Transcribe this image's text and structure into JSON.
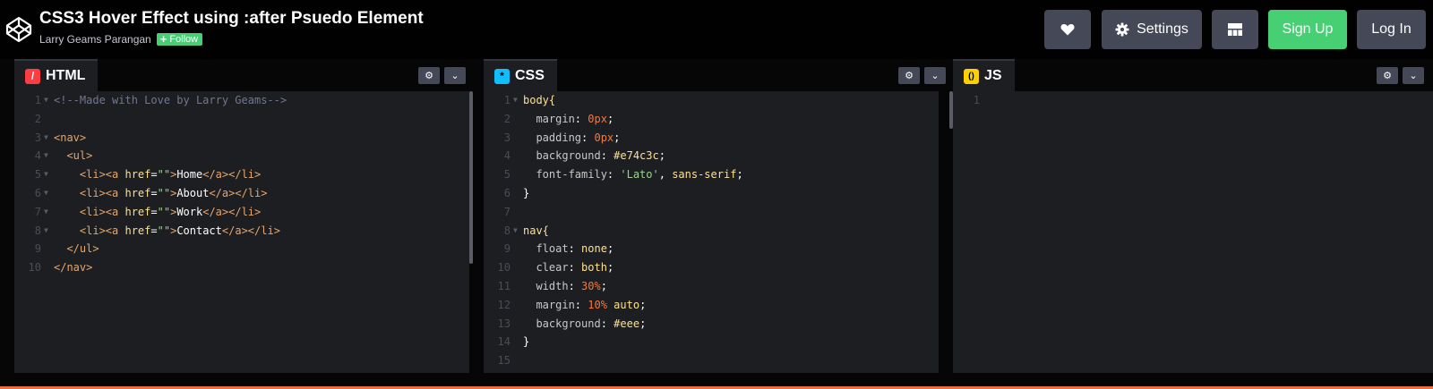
{
  "header": {
    "title": "CSS3 Hover Effect using :after Psuedo Element",
    "author": "Larry Geams Parangan",
    "follow_label": "Follow",
    "settings_label": "Settings",
    "signup_label": "Sign Up",
    "login_label": "Log In"
  },
  "editors": {
    "html": {
      "label": "HTML",
      "icon": "/",
      "lines": [
        [
          {
            "t": "<!--Made with Love by Larry Geams-->",
            "c": "t-comment"
          }
        ],
        [],
        [
          {
            "t": "<nav>",
            "c": "t-tag"
          }
        ],
        [
          {
            "t": "  <ul>",
            "c": "t-tag"
          }
        ],
        [
          {
            "t": "    <li><a ",
            "c": "t-tag"
          },
          {
            "t": "href",
            "c": "t-attr"
          },
          {
            "t": "=",
            "c": "t-plain"
          },
          {
            "t": "\"\"",
            "c": "t-str"
          },
          {
            "t": ">",
            "c": "t-tag"
          },
          {
            "t": "Home",
            "c": "t-plain"
          },
          {
            "t": "</a></li>",
            "c": "t-tag"
          }
        ],
        [
          {
            "t": "    <li><a ",
            "c": "t-tag"
          },
          {
            "t": "href",
            "c": "t-attr"
          },
          {
            "t": "=",
            "c": "t-plain"
          },
          {
            "t": "\"\"",
            "c": "t-str"
          },
          {
            "t": ">",
            "c": "t-tag"
          },
          {
            "t": "About",
            "c": "t-plain"
          },
          {
            "t": "</a></li>",
            "c": "t-tag"
          }
        ],
        [
          {
            "t": "    <li><a ",
            "c": "t-tag"
          },
          {
            "t": "href",
            "c": "t-attr"
          },
          {
            "t": "=",
            "c": "t-plain"
          },
          {
            "t": "\"\"",
            "c": "t-str"
          },
          {
            "t": ">",
            "c": "t-tag"
          },
          {
            "t": "Work",
            "c": "t-plain"
          },
          {
            "t": "</a></li>",
            "c": "t-tag"
          }
        ],
        [
          {
            "t": "    <li><a ",
            "c": "t-tag"
          },
          {
            "t": "href",
            "c": "t-attr"
          },
          {
            "t": "=",
            "c": "t-plain"
          },
          {
            "t": "\"\"",
            "c": "t-str"
          },
          {
            "t": ">",
            "c": "t-tag"
          },
          {
            "t": "Contact",
            "c": "t-plain"
          },
          {
            "t": "</a></li>",
            "c": "t-tag"
          }
        ],
        [
          {
            "t": "  </ul>",
            "c": "t-tag"
          }
        ],
        [
          {
            "t": "</nav>",
            "c": "t-tag"
          }
        ]
      ],
      "folds": [
        1,
        3,
        4,
        5,
        6,
        7,
        8
      ]
    },
    "css": {
      "label": "CSS",
      "icon": "*",
      "lines": [
        [
          {
            "t": "body{",
            "c": "t-sel"
          }
        ],
        [
          {
            "t": "  margin",
            "c": "t-prop"
          },
          {
            "t": ": ",
            "c": "t-plain"
          },
          {
            "t": "0px",
            "c": "t-num"
          },
          {
            "t": ";",
            "c": "t-plain"
          }
        ],
        [
          {
            "t": "  padding",
            "c": "t-prop"
          },
          {
            "t": ": ",
            "c": "t-plain"
          },
          {
            "t": "0px",
            "c": "t-num"
          },
          {
            "t": ";",
            "c": "t-plain"
          }
        ],
        [
          {
            "t": "  background",
            "c": "t-prop"
          },
          {
            "t": ": ",
            "c": "t-plain"
          },
          {
            "t": "#e74c3c",
            "c": "t-hex"
          },
          {
            "t": ";",
            "c": "t-plain"
          }
        ],
        [
          {
            "t": "  font-family",
            "c": "t-prop"
          },
          {
            "t": ": ",
            "c": "t-plain"
          },
          {
            "t": "'Lato'",
            "c": "t-str"
          },
          {
            "t": ", ",
            "c": "t-plain"
          },
          {
            "t": "sans-serif",
            "c": "t-kw"
          },
          {
            "t": ";",
            "c": "t-plain"
          }
        ],
        [
          {
            "t": "}",
            "c": "t-plain"
          }
        ],
        [],
        [
          {
            "t": "nav{",
            "c": "t-sel"
          }
        ],
        [
          {
            "t": "  float",
            "c": "t-prop"
          },
          {
            "t": ": ",
            "c": "t-plain"
          },
          {
            "t": "none",
            "c": "t-kw"
          },
          {
            "t": ";",
            "c": "t-plain"
          }
        ],
        [
          {
            "t": "  clear",
            "c": "t-prop"
          },
          {
            "t": ": ",
            "c": "t-plain"
          },
          {
            "t": "both",
            "c": "t-kw"
          },
          {
            "t": ";",
            "c": "t-plain"
          }
        ],
        [
          {
            "t": "  width",
            "c": "t-prop"
          },
          {
            "t": ": ",
            "c": "t-plain"
          },
          {
            "t": "30%",
            "c": "t-num"
          },
          {
            "t": ";",
            "c": "t-plain"
          }
        ],
        [
          {
            "t": "  margin",
            "c": "t-prop"
          },
          {
            "t": ": ",
            "c": "t-plain"
          },
          {
            "t": "10%",
            "c": "t-num"
          },
          {
            "t": " ",
            "c": "t-plain"
          },
          {
            "t": "auto",
            "c": "t-kw"
          },
          {
            "t": ";",
            "c": "t-plain"
          }
        ],
        [
          {
            "t": "  background",
            "c": "t-prop"
          },
          {
            "t": ": ",
            "c": "t-plain"
          },
          {
            "t": "#eee",
            "c": "t-hex"
          },
          {
            "t": ";",
            "c": "t-plain"
          }
        ],
        [
          {
            "t": "}",
            "c": "t-plain"
          }
        ],
        []
      ],
      "folds": [
        1,
        8
      ]
    },
    "js": {
      "label": "JS",
      "icon": "()",
      "lines": [
        []
      ],
      "folds": []
    }
  },
  "colors": {
    "html_icon": "#ff3c41",
    "css_icon": "#0ebeff",
    "js_icon": "#fcd000",
    "green": "#47cf73",
    "button": "#444857"
  }
}
